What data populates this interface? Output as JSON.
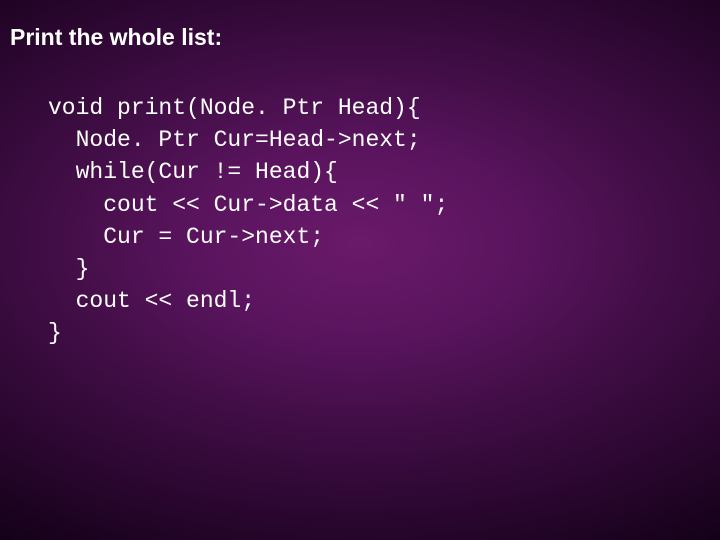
{
  "slide": {
    "title": "Print the whole list:",
    "code": {
      "line1": "void print(Node. Ptr Head){",
      "line2": "  Node. Ptr Cur=Head->next;",
      "line3": "  while(Cur != Head){",
      "line4": "    cout << Cur->data << \" \";",
      "line5": "    Cur = Cur->next;",
      "line6": "  }",
      "line7": "  cout << endl;",
      "line8": "}"
    }
  }
}
